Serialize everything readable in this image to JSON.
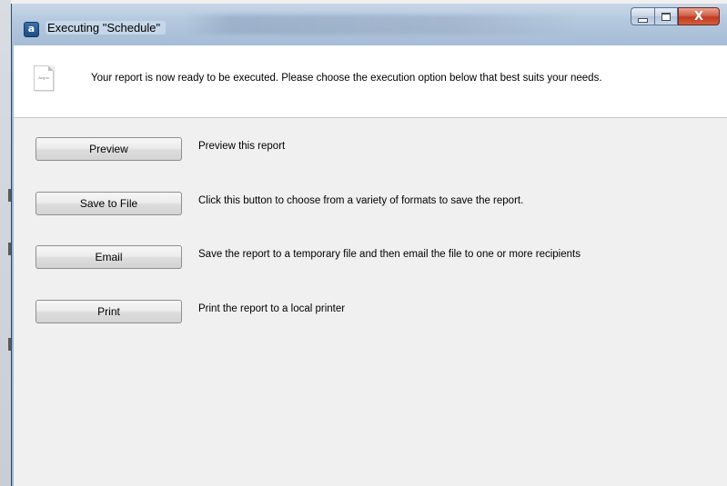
{
  "window": {
    "title": "Executing \"Schedule\"",
    "app_icon_letter": "a",
    "controls": {
      "minimize": "minimize-icon",
      "maximize": "maximize-icon",
      "close": "close-icon",
      "close_glyph": "X"
    }
  },
  "banner": {
    "icon": "report-document-icon",
    "icon_label": "Argos",
    "message": "Your report is now ready to be executed.  Please choose the execution option below that best suits your needs."
  },
  "options": [
    {
      "label": "Preview",
      "description": "Preview this report"
    },
    {
      "label": "Save to File",
      "description": "Click this button to choose from a variety of formats to save the report."
    },
    {
      "label": "Email",
      "description": "Save the report to a temporary file and then email the file to one or more recipients"
    },
    {
      "label": "Print",
      "description": "Print the report to a local printer"
    }
  ]
}
